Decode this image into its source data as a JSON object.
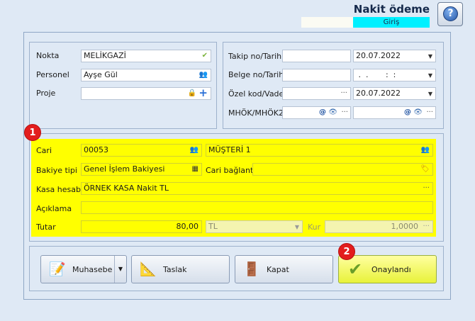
{
  "header": {
    "title": "Nakit ödeme",
    "mode": "Giriş",
    "help_icon": "help-question-icon"
  },
  "left_group": {
    "nokta_label": "Nokta",
    "nokta_value": "MELİKGAZİ",
    "personel_label": "Personel",
    "personel_value": "Ayşe Gül",
    "proje_label": "Proje",
    "proje_value": ""
  },
  "right_group": {
    "takip_label": "Takip no/Tarih",
    "takip_no": "",
    "takip_tarih": "20.07.2022",
    "belge_label": "Belge no/Tarih",
    "belge_no": "",
    "belge_tarih": " .  .       :  :",
    "ozel_label": "Özel kod/Vade",
    "ozel_kod": "",
    "vade": "20.07.2022",
    "mhok_label": "MHÖK/MHÖK2",
    "mhok1": "",
    "mhok2": ""
  },
  "middle_group": {
    "cari_label": "Cari",
    "cari_code": "00053",
    "cari_name": "MÜŞTERİ 1",
    "bakiye_label": "Bakiye tipi",
    "bakiye_value": "Genel İşlem Bakiyesi",
    "cari_baglanti_label": "Cari bağlantı",
    "cari_baglanti_value": "",
    "kasa_label": "Kasa hesabı",
    "kasa_value": "ÖRNEK KASA Nakit TL",
    "aciklama_label": "Açıklama",
    "aciklama_value": "",
    "tutar_label": "Tutar",
    "tutar_value": "80,00",
    "currency_value": "TL",
    "kur_label": "Kur",
    "kur_value": "1,0000"
  },
  "badges": {
    "one": "1",
    "two": "2"
  },
  "buttons": {
    "muhasebe": "Muhasebe",
    "taslak": "Taslak",
    "kapat": "Kapat",
    "onay": "Onaylandı"
  },
  "symbols": {
    "check": "✔",
    "people": "👥",
    "lock": "🔒",
    "plus": "+",
    "ellipsis": "···",
    "caret": "▼",
    "at": "@",
    "eye": "👁",
    "calc": "▦",
    "tag": "🏷"
  }
}
